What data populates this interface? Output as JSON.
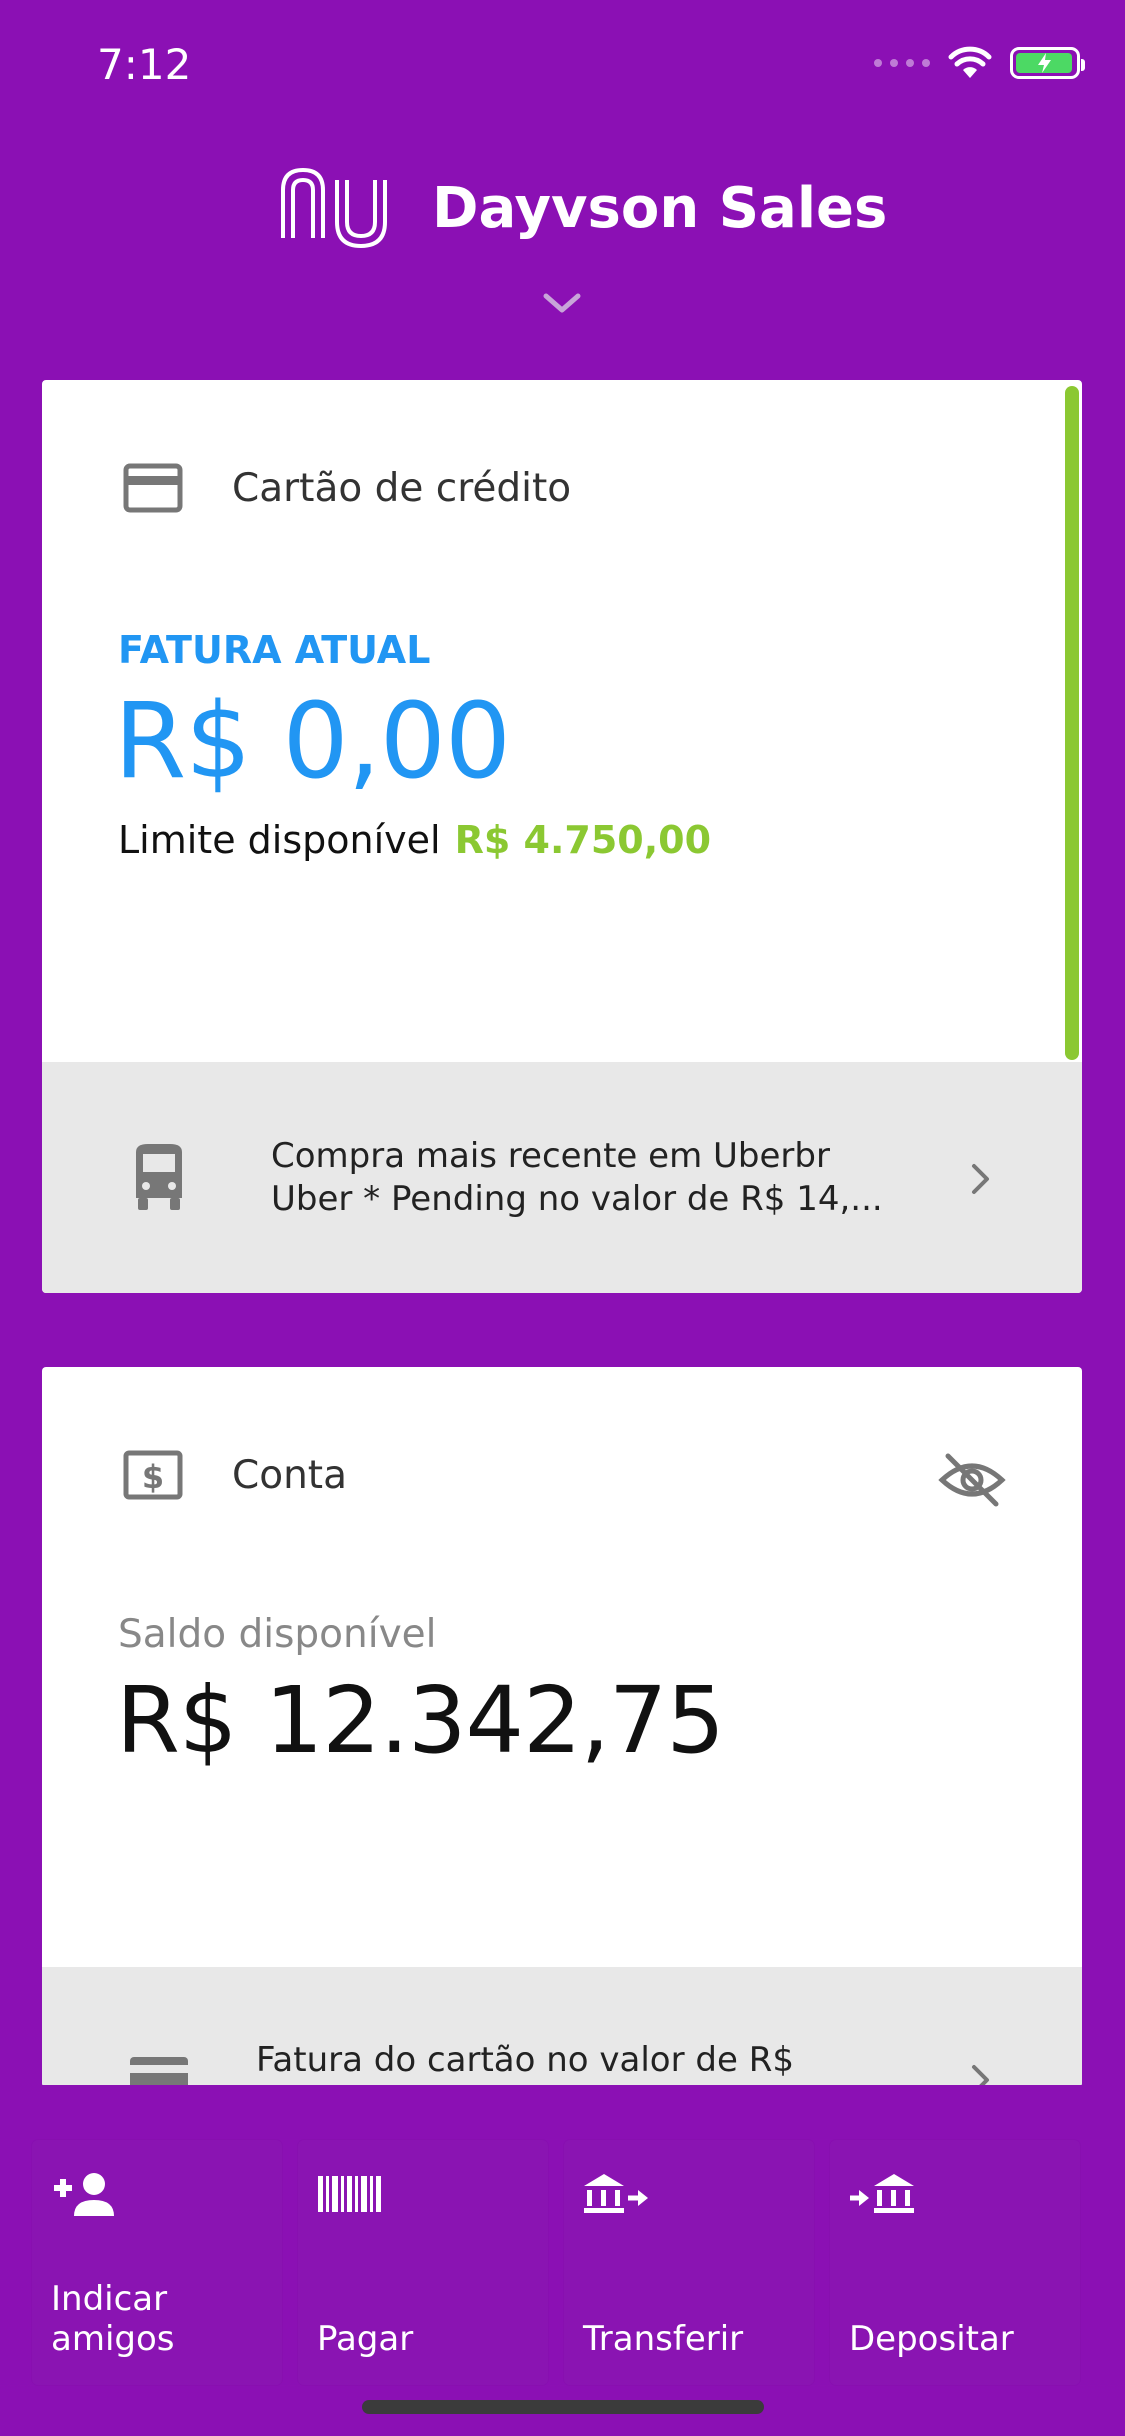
{
  "status": {
    "time": "7:12"
  },
  "header": {
    "user_name": "Dayvson Sales"
  },
  "credit_card": {
    "title": "Cartão de crédito",
    "fatura_label": "FATURA ATUAL",
    "fatura_value": "R$ 0,00",
    "limite_label": "Limite disponível",
    "limite_value": "R$ 4.750,00",
    "recent_line1": "Compra mais recente em Uberbr",
    "recent_line2": "Uber * Pending no valor de R$ 14,..."
  },
  "account": {
    "title": "Conta",
    "saldo_label": "Saldo disponível",
    "saldo_value": "R$ 12.342,75",
    "footer_text": "Fatura do cartão no valor de R$"
  },
  "actions": [
    {
      "label": "Indicar\namigos",
      "icon": "add-person-icon"
    },
    {
      "label": "Pagar",
      "icon": "barcode-icon"
    },
    {
      "label": "Transferir",
      "icon": "bank-transfer-out-icon"
    },
    {
      "label": "Depositar",
      "icon": "bank-deposit-in-icon"
    }
  ],
  "colors": {
    "background": "#8B10B4",
    "accent_blue": "#2196F3",
    "accent_green": "#8BC832"
  }
}
